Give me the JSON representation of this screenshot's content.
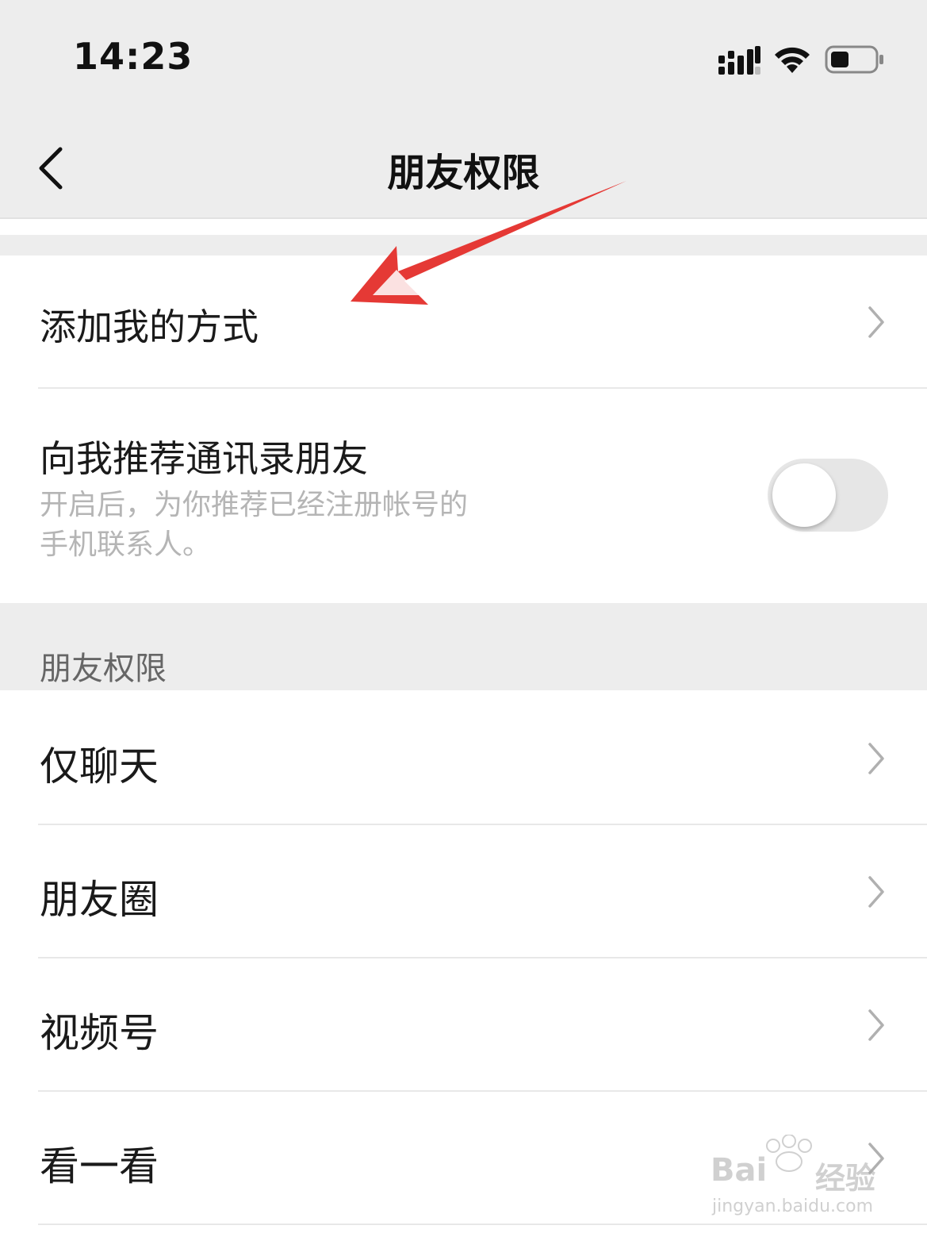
{
  "status_bar": {
    "time": "14:23"
  },
  "nav": {
    "title": "朋友权限"
  },
  "section1": {
    "add_me_label": "添加我的方式",
    "recommend_label": "向我推荐通讯录朋友",
    "recommend_desc_line1": "开启后，为你推荐已经注册帐号的",
    "recommend_desc_line2": "手机联系人。",
    "recommend_toggle_on": false
  },
  "section2": {
    "header": "朋友权限",
    "items": [
      {
        "label": "仅聊天"
      },
      {
        "label": "朋友圈"
      },
      {
        "label": "视频号"
      },
      {
        "label": "看一看"
      }
    ]
  },
  "watermark": {
    "brand": "Bai",
    "brand2": "经验",
    "url": "jingyan.baidu.com"
  },
  "colors": {
    "annotation_arrow": "#e53935",
    "background_gray": "#ededed"
  }
}
